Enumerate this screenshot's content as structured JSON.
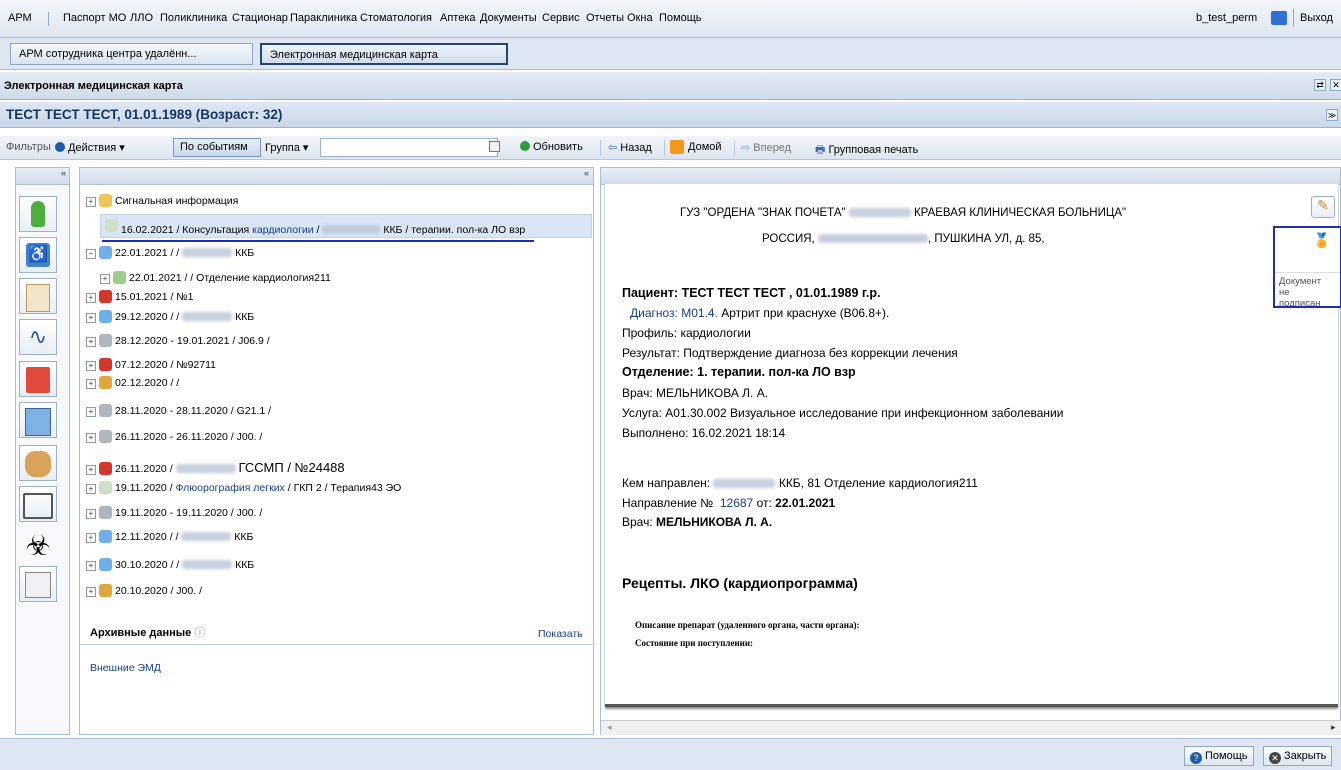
{
  "menu": {
    "items": [
      "АРМ",
      "Паспорт МО",
      "ЛЛО",
      "Поликлиника",
      "Стационар",
      "Параклиника",
      "Стоматология",
      "Аптека",
      "Документы",
      "Сервис",
      "Отчеты",
      "Окна",
      "Помощь"
    ],
    "user": "b_test_perm",
    "logout": "Выход"
  },
  "tasks": [
    "АРМ сотрудника центра удалённ...",
    "Электронная медицинская карта"
  ],
  "panel_title": "Электронная медицинская карта",
  "patient_title": "ТЕСТ ТЕСТ ТЕСТ, 01.01.1989 (Возраст: 32)",
  "toolbar": {
    "filters": "Фильтры",
    "actions": "Действия",
    "by_events": "По событиям",
    "group": "Группа",
    "refresh": "Обновить",
    "back": "Назад",
    "home": "Домой",
    "forward": "Вперед",
    "group_print": "Групповая печать"
  },
  "tree": {
    "rows": [
      {
        "text": "Сигнальная информация"
      },
      {
        "text": "16.02.2021 / Консультация",
        "link": "кардиологии",
        "tail": "ККБ / терапии. пол-ка ЛО взр"
      },
      {
        "text": "22.01.2021 /  /",
        "tail": "ККБ"
      },
      {
        "text": "22.01.2021 /  / Отделение кардиология211"
      },
      {
        "text": "15.01.2021 / №1"
      },
      {
        "text": "29.12.2020 /  /",
        "tail": "ККБ"
      },
      {
        "text": "28.12.2020 - 19.01.2021 / J06.9 /"
      },
      {
        "text": "07.12.2020 / №92711"
      },
      {
        "text": "02.12.2020 /  /"
      },
      {
        "text": "28.11.2020 - 28.11.2020 / G21.1 /"
      },
      {
        "text": "26.11.2020 - 26.11.2020 / J00. /"
      },
      {
        "text": "26.11.2020 /",
        "tail": "ГССМП / №24488"
      },
      {
        "text": "19.11.2020 /",
        "link": "Флюорография легких",
        "tail": "/ ГКП 2 / Терапия43 ЭО"
      },
      {
        "text": "19.11.2020 - 19.11.2020 / J00. /"
      },
      {
        "text": "12.11.2020 /  /",
        "tail": "ККБ"
      },
      {
        "text": "30.10.2020 /  /",
        "tail": "ККБ"
      },
      {
        "text": "20.10.2020 /  J00.  /"
      }
    ],
    "archive_label": "Архивные данные",
    "archive_show": "Показать",
    "external": "Внешние ЭМД"
  },
  "doc": {
    "org_line1_a": "ГУЗ \"ОРДЕНА \"ЗНАК ПОЧЕТА\"",
    "org_line1_b": "КРАЕВАЯ КЛИНИЧЕСКАЯ БОЛЬНИЦА\"",
    "org_line2_a": "РОССИЯ,",
    "org_line2_b": ", ПУШКИНА УЛ, д. 85,",
    "patient": "Пациент: ТЕСТ ТЕСТ ТЕСТ , 01.01.1989 г.р.",
    "diag_label": "Диагноз:",
    "diag_code": "М01.4.",
    "diag_text": "Артрит при краснухе (B06.8+).",
    "profile": "Профиль: кардиологии",
    "result": "Результат: Подтверждение диагноза без коррекции лечения",
    "dept": "Отделение: 1. терапии. пол-ка ЛО взр",
    "doctor": "Врач: МЕЛЬНИКОВА Л. А.",
    "service": "Услуга: А01.30.002 Визуальное исследование при инфекционном заболевании",
    "done": "Выполнено: 16.02.2021 18:14",
    "sent_by_a": "Кем направлен:",
    "sent_by_b": "ККБ, 81 Отделение кардиология211",
    "referral_label": "Направление №",
    "referral_num": "12687",
    "referral_from": "от:",
    "referral_date": "22.01.2021",
    "ref_doctor_label": "Врач:",
    "ref_doctor": "МЕЛЬНИКОВА Л. А.",
    "recipes": "Рецепты. ЛКО (кардиопрограмма)",
    "desc1": "Описание препарат (удаленного органа, части органа):",
    "desc2": "Состояние при поступлении:"
  },
  "tooltip": [
    "Документ",
    "не",
    "подписан"
  ],
  "bottom": {
    "help": "Помощь",
    "close": "Закрыть"
  },
  "colors": {
    "accent": "#1f5aa8",
    "highlight_border": "#1a2fb5",
    "header_bg": "#cfdbea"
  }
}
